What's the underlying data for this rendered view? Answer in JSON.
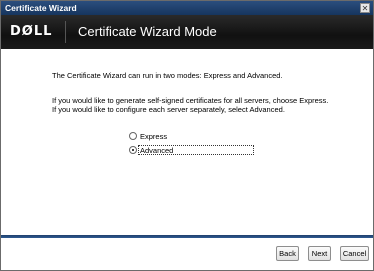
{
  "window": {
    "title": "Certificate Wizard",
    "close_glyph": "✕"
  },
  "banner": {
    "logo": "DØLL",
    "title": "Certificate Wizard Mode"
  },
  "content": {
    "intro": "The Certificate Wizard can run in two modes: Express and Advanced.",
    "line1": "If you would like to generate self-signed certificates for all servers, choose Express.",
    "line2": "If you would like to configure each server separately, select Advanced."
  },
  "options": [
    {
      "label": "Express",
      "selected": false
    },
    {
      "label": "Advanced",
      "selected": true
    }
  ],
  "buttons": {
    "back": "Back",
    "next": "Next",
    "cancel": "Cancel"
  },
  "colors": {
    "titlebar": "#1f3f6b",
    "banner": "#1a1a1a",
    "accent_rule": "#2f5a93"
  }
}
